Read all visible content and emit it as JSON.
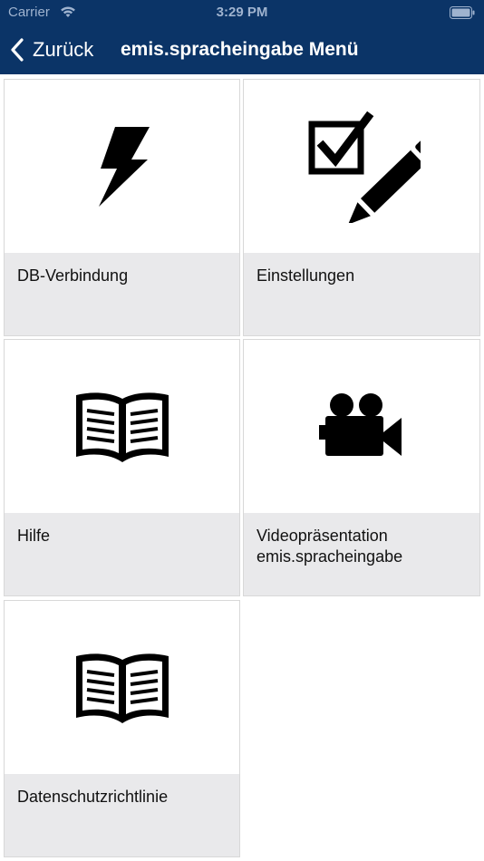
{
  "status_bar": {
    "carrier": "Carrier",
    "time": "3:29 PM"
  },
  "nav_bar": {
    "back_label": "Zurück",
    "title": "emis.spracheingabe Menü"
  },
  "menu": {
    "items": [
      {
        "label": "DB-Verbindung",
        "icon": "lightning-icon"
      },
      {
        "label": "Einstellungen",
        "icon": "checkbox-pencil-icon"
      },
      {
        "label": "Hilfe",
        "icon": "book-icon"
      },
      {
        "label": "Videopräsentation\nemis.spracheingabe",
        "icon": "video-camera-icon"
      },
      {
        "label": "Datenschutzrichtlinie",
        "icon": "book-icon"
      }
    ]
  },
  "colors": {
    "nav_background": "#0b3467",
    "tile_label_background": "#e9e9eb"
  }
}
